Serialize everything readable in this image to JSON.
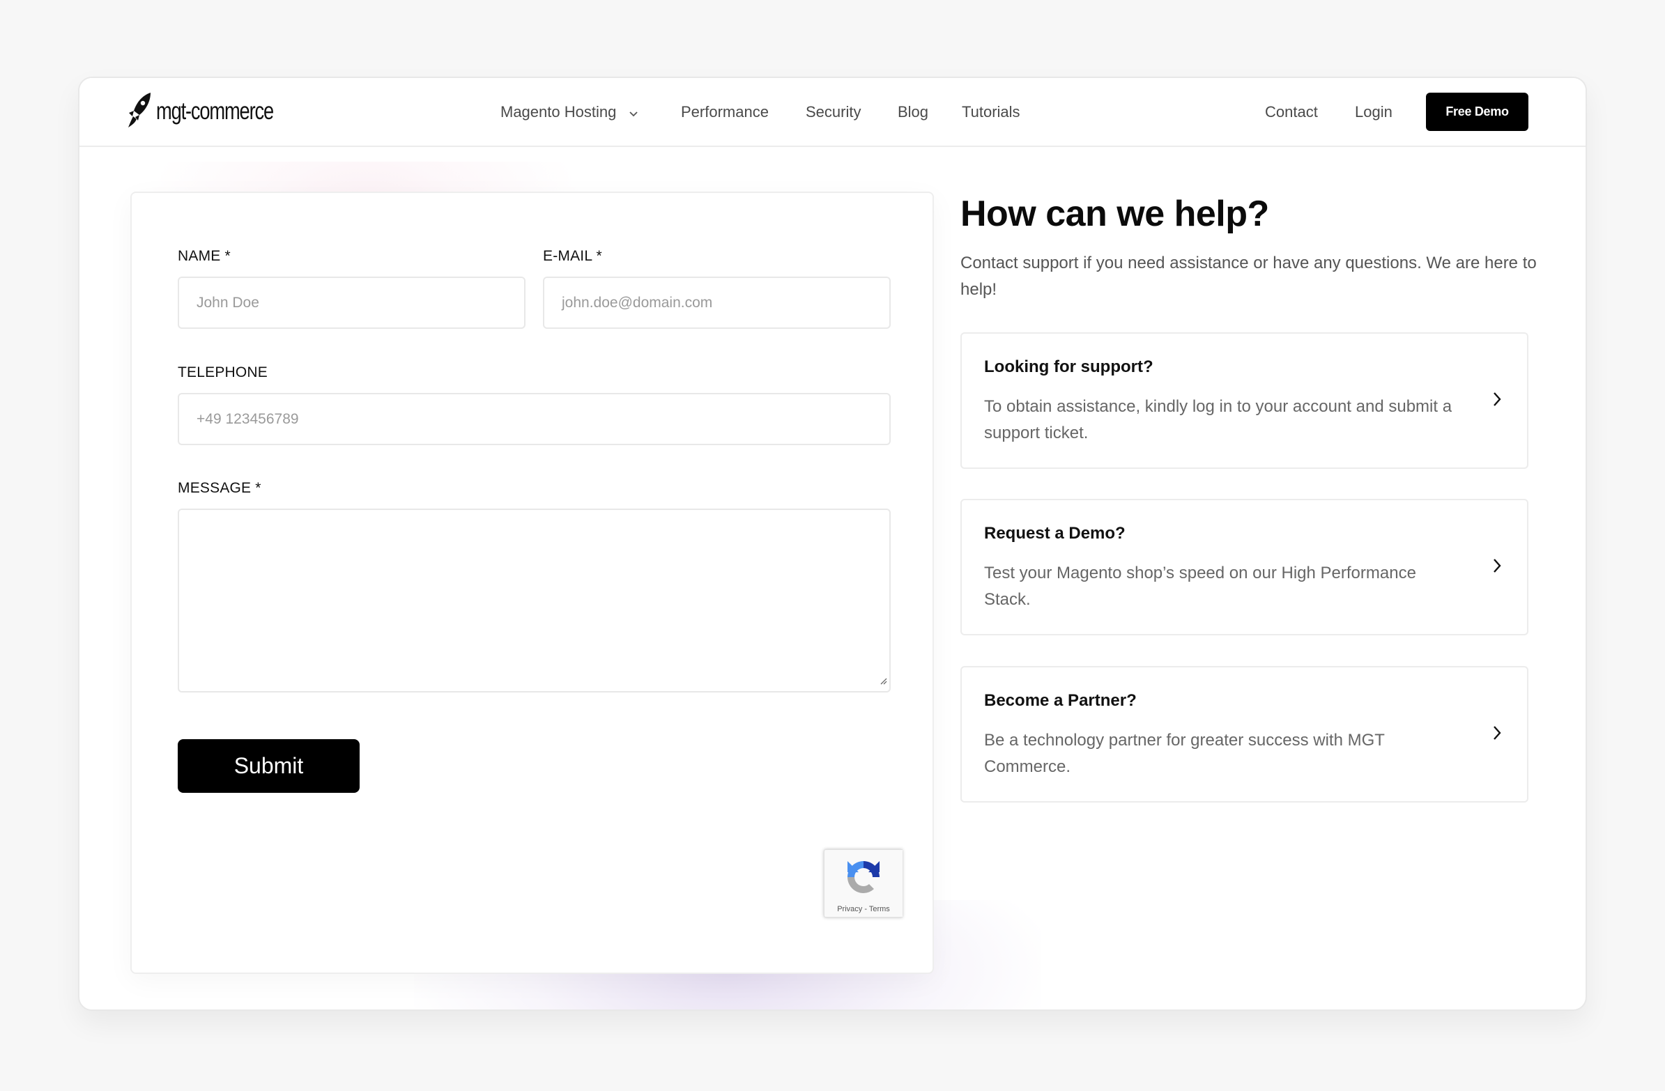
{
  "brand": {
    "name": "mgt-commerce",
    "logo_icon": "rocket-icon"
  },
  "nav": {
    "items": [
      {
        "label": "Magento Hosting",
        "has_dropdown": true
      },
      {
        "label": "Performance"
      },
      {
        "label": "Security"
      },
      {
        "label": "Blog"
      },
      {
        "label": "Tutorials"
      }
    ],
    "contact_label": "Contact",
    "login_label": "Login",
    "cta_label": "Free Demo"
  },
  "form": {
    "name": {
      "label": "NAME *",
      "placeholder": "John Doe",
      "value": ""
    },
    "email": {
      "label": "E-MAIL *",
      "placeholder": "john.doe@domain.com",
      "value": ""
    },
    "telephone": {
      "label": "TELEPHONE",
      "placeholder": "+49 123456789",
      "value": ""
    },
    "message": {
      "label": "MESSAGE *",
      "placeholder": "",
      "value": ""
    },
    "submit_label": "Submit",
    "recaptcha": {
      "links": "Privacy - Terms"
    }
  },
  "help": {
    "title": "How can we help?",
    "description": "Contact support if you need assistance or have any questions. We are here to help!",
    "cards": [
      {
        "title": "Looking for support?",
        "text": "To obtain assistance, kindly log in to your account and submit a support ticket."
      },
      {
        "title": "Request a Demo?",
        "text": "Test your Magento shop’s speed on our High Performance Stack."
      },
      {
        "title": "Become a Partner?",
        "text": "Be a technology partner for greater success with MGT Commerce."
      }
    ]
  },
  "colors": {
    "accent": "#000000",
    "background": "#f7f7f7",
    "text_muted": "#666666"
  }
}
